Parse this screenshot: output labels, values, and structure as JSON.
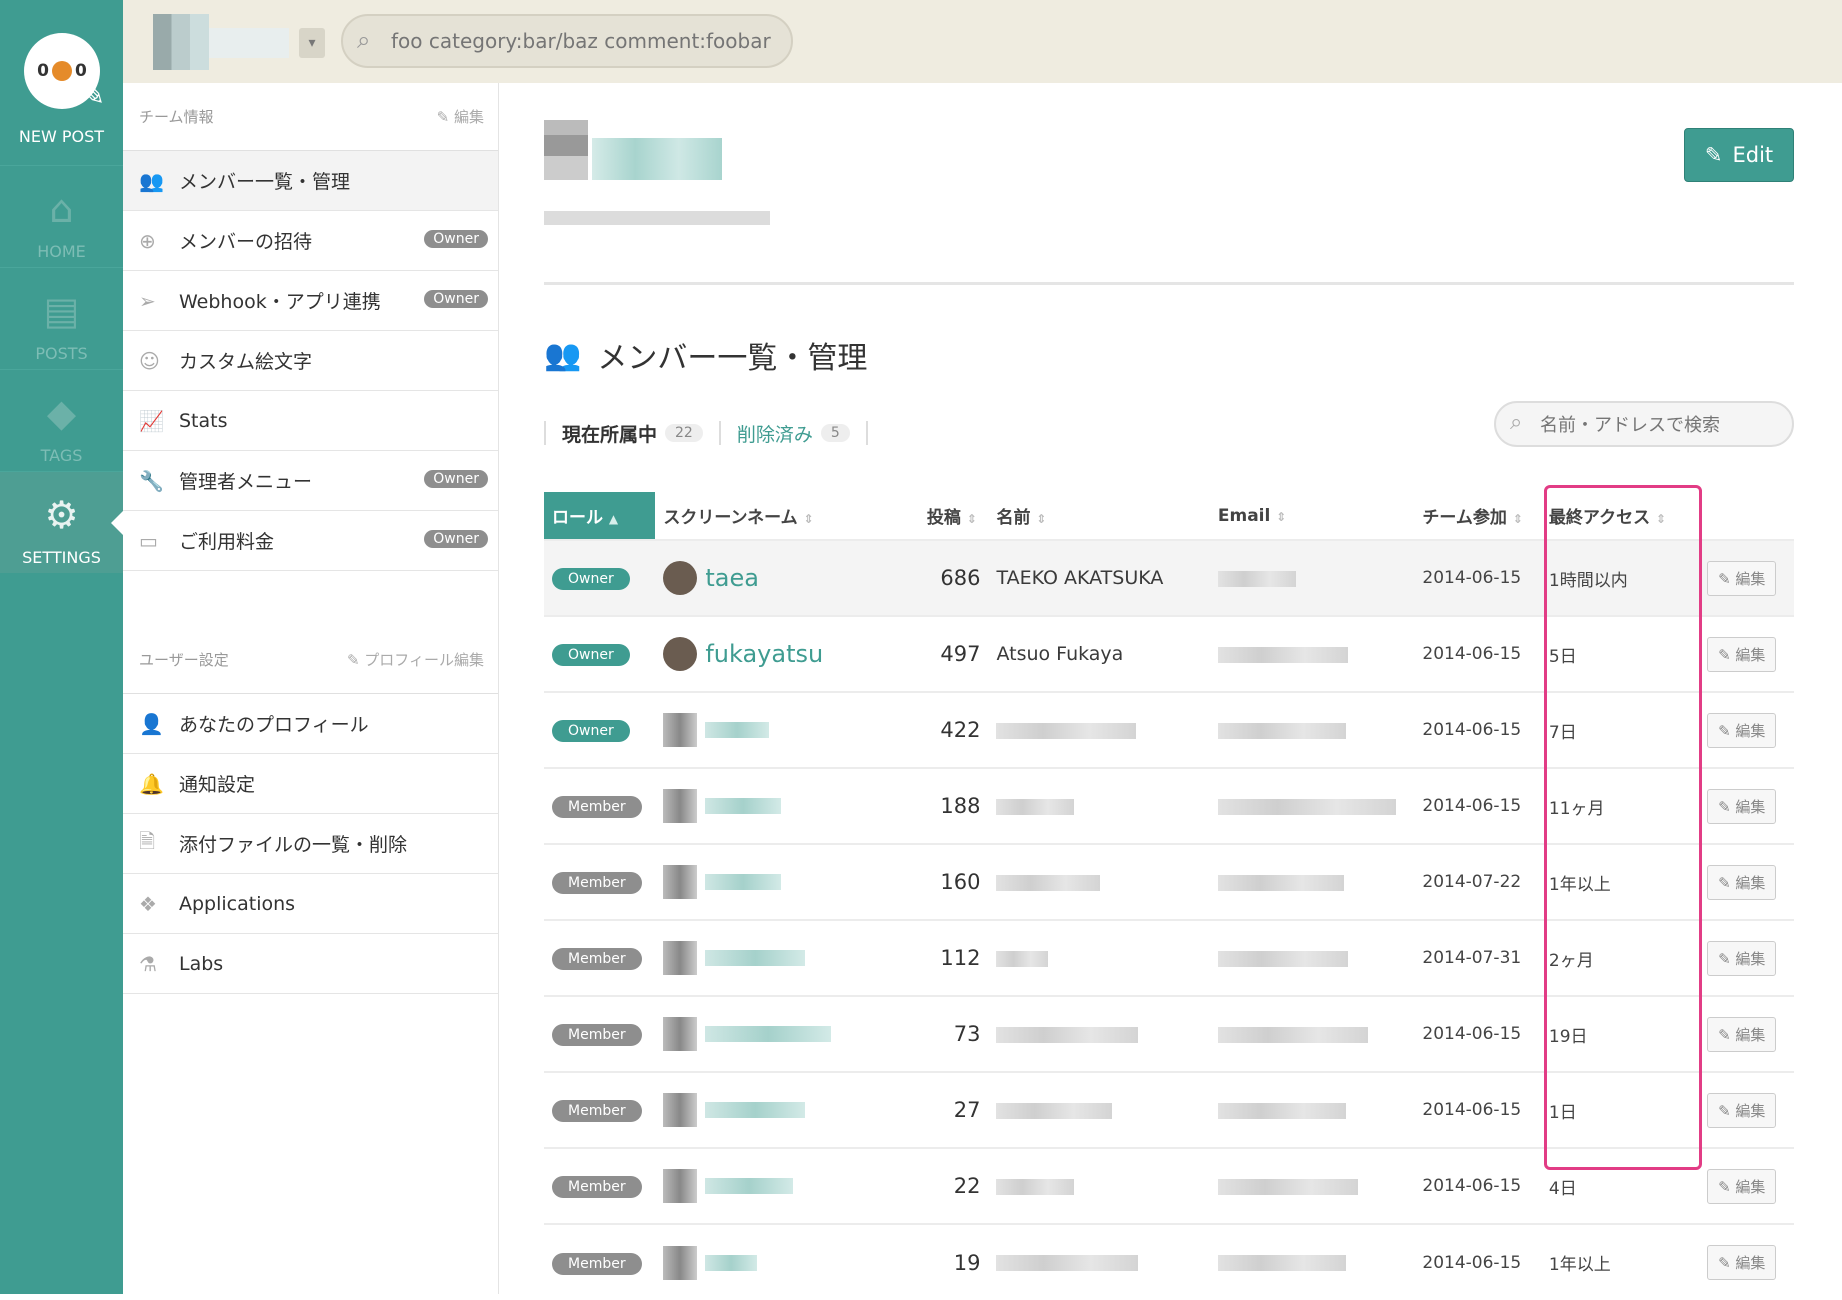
{
  "rail": {
    "logo_text_left": "0",
    "logo_text_right": "0",
    "new_post": "NEW POST",
    "items": [
      {
        "label": "HOME",
        "icon": "home-icon"
      },
      {
        "label": "POSTS",
        "icon": "document-icon"
      },
      {
        "label": "TAGS",
        "icon": "tag-icon"
      },
      {
        "label": "SETTINGS",
        "icon": "gear-icon",
        "active": true
      }
    ]
  },
  "topbar": {
    "search_placeholder": "foo category:bar/baz comment:foobar"
  },
  "sidebar": {
    "team_section": {
      "title": "チーム情報",
      "edit": "編集"
    },
    "team_items": [
      {
        "label": "メンバー一覧・管理",
        "badge": ""
      },
      {
        "label": "メンバーの招待",
        "badge": "Owner"
      },
      {
        "label": "Webhook・アプリ連携",
        "badge": "Owner"
      },
      {
        "label": "カスタム絵文字",
        "badge": ""
      },
      {
        "label": "Stats",
        "badge": ""
      },
      {
        "label": "管理者メニュー",
        "badge": "Owner"
      },
      {
        "label": "ご利用料金",
        "badge": "Owner"
      }
    ],
    "user_section": {
      "title": "ユーザー設定",
      "edit": "プロフィール編集"
    },
    "user_items": [
      {
        "label": "あなたのプロフィール"
      },
      {
        "label": "通知設定"
      },
      {
        "label": "添付ファイルの一覧・削除"
      },
      {
        "label": "Applications"
      },
      {
        "label": "Labs"
      }
    ]
  },
  "main": {
    "edit_button": "Edit",
    "page_title": "メンバー一覧・管理",
    "tabs": {
      "current": {
        "label": "現在所属中",
        "count": "22"
      },
      "deleted": {
        "label": "削除済み",
        "count": "5"
      }
    },
    "member_search_placeholder": "名前・アドレスで検索",
    "columns": {
      "role": "ロール",
      "screen_name": "スクリーンネーム",
      "posts": "投稿",
      "name": "名前",
      "email": "Email",
      "joined": "チーム参加",
      "last_access": "最終アクセス"
    },
    "row_button": "編集",
    "rows": [
      {
        "role": "Owner",
        "screen_name": "taea",
        "posts": "686",
        "name": "TAEKO AKATSUKA",
        "joined": "2014-06-15",
        "last_access": "1時間以内"
      },
      {
        "role": "Owner",
        "screen_name": "fukayatsu",
        "posts": "497",
        "name": "Atsuo Fukaya",
        "joined": "2014-06-15",
        "last_access": "5日"
      },
      {
        "role": "Owner",
        "screen_name": "",
        "posts": "422",
        "name": "",
        "joined": "2014-06-15",
        "last_access": "7日"
      },
      {
        "role": "Member",
        "screen_name": "",
        "posts": "188",
        "name": "",
        "joined": "2014-06-15",
        "last_access": "11ヶ月"
      },
      {
        "role": "Member",
        "screen_name": "",
        "posts": "160",
        "name": "",
        "joined": "2014-07-22",
        "last_access": "1年以上"
      },
      {
        "role": "Member",
        "screen_name": "",
        "posts": "112",
        "name": "",
        "joined": "2014-07-31",
        "last_access": "2ヶ月"
      },
      {
        "role": "Member",
        "screen_name": "",
        "posts": "73",
        "name": "",
        "joined": "2014-06-15",
        "last_access": "19日"
      },
      {
        "role": "Member",
        "screen_name": "",
        "posts": "27",
        "name": "",
        "joined": "2014-06-15",
        "last_access": "1日"
      },
      {
        "role": "Member",
        "screen_name": "",
        "posts": "22",
        "name": "",
        "joined": "2014-06-15",
        "last_access": "4日"
      },
      {
        "role": "Member",
        "screen_name": "",
        "posts": "19",
        "name": "",
        "joined": "2014-06-15",
        "last_access": "1年以上"
      }
    ]
  },
  "colors": {
    "accent": "#3f9c91",
    "highlight": "#e23c85",
    "member_badge": "#8e8e8e"
  }
}
